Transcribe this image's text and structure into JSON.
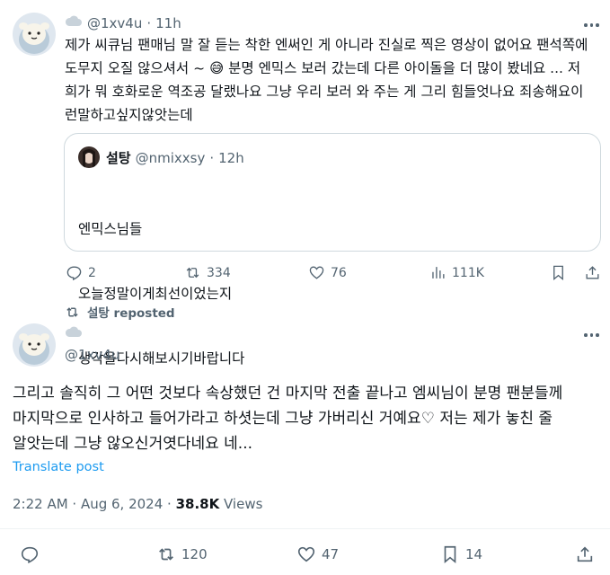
{
  "tweet1": {
    "handle": "@1xv4u",
    "separator": "·",
    "time": "11h",
    "text": "제가 씨큐님 팬매님 말 잘 듣는 착한 엔써인 게 아니라 진실로 찍은 영상이 없어요 팬석쪽에\n도무지 오질 않으셔서 ~ 😅 분명 엔믹스 보러 갔는데 다른 아이돌을 더 많이 봤네요 ... 저\n희가 뭐 호화로운 역조공 달랬나요 그냥 우리 보러 와 주는 게 그리 힘들엇나요 죄송해요이\n런말하고싶지않앗는데",
    "quote": {
      "name": "설탕",
      "handle": "@nmixxsy",
      "separator": "·",
      "time": "12h",
      "lines": [
        "엔믹스님들",
        "오늘정말이게최선이었는지",
        "생각을다시해보시기바랍니다"
      ]
    },
    "actions": {
      "replies": "2",
      "reposts": "334",
      "likes": "76",
      "views": "111K"
    }
  },
  "repost_label": "설탕 reposted",
  "tweet2": {
    "handle": "@1xv4u",
    "text": "그리고 솔직히 그 어떤 것보다 속상했던 건 마지막 전출 끝나고 엠씨님이 분명 팬분들께\n마지막으로 인사하고 들어가라고 하셧는데 그냥 가버리신 거예요♡ 저는 제가 놓친 줄\n알앗는데 그냥 않오신거엿다네요 네...",
    "translate": "Translate post",
    "timestamp": "2:22 AM · Aug 6, 2024 · ",
    "views_count": "38.8K",
    "views_label": " Views",
    "actions": {
      "reposts": "120",
      "likes": "47",
      "bookmarks": "14"
    }
  },
  "colors": {
    "accent": "#1d9bf0",
    "text": "#0f1419",
    "secondary": "#536471",
    "border": "#cfd9de"
  }
}
